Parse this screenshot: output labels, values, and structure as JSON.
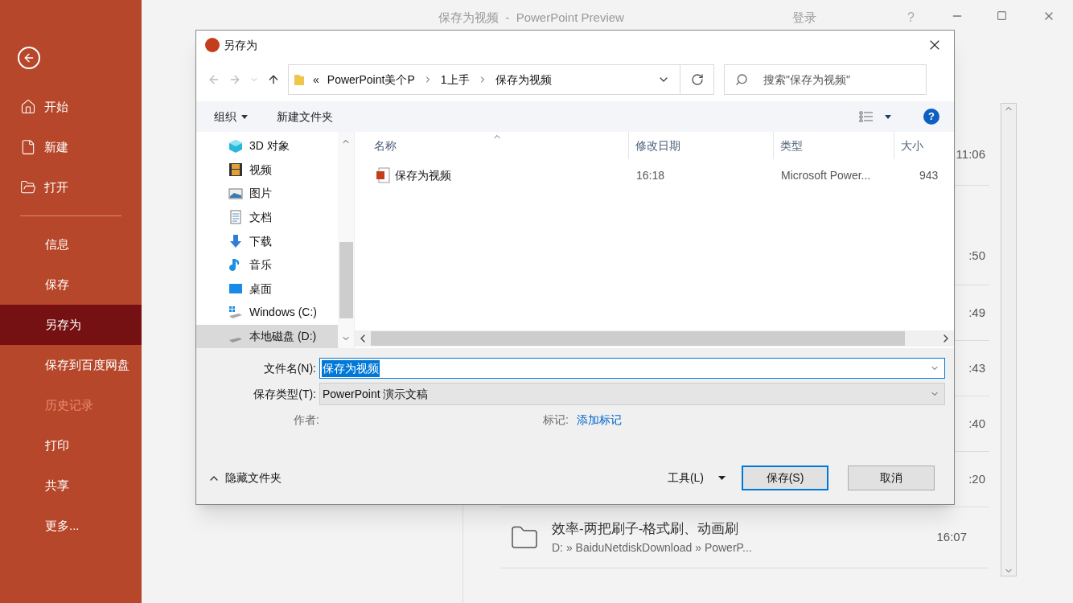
{
  "app": {
    "title": "保存为视频  -  PowerPoint Preview",
    "sign_in": "登录",
    "help": "?"
  },
  "sidebar": {
    "top_items": [
      {
        "label": "开始"
      },
      {
        "label": "新建"
      },
      {
        "label": "打开"
      }
    ],
    "items": [
      {
        "label": "信息",
        "selected": false,
        "disabled": false
      },
      {
        "label": "保存",
        "selected": false,
        "disabled": false
      },
      {
        "label": "另存为",
        "selected": true,
        "disabled": false
      },
      {
        "label": "保存到百度网盘",
        "selected": false,
        "disabled": false
      },
      {
        "label": "历史记录",
        "selected": false,
        "disabled": true
      },
      {
        "label": "打印",
        "selected": false,
        "disabled": false
      },
      {
        "label": "共享",
        "selected": false,
        "disabled": false
      },
      {
        "label": "更多...",
        "selected": false,
        "disabled": false
      }
    ]
  },
  "backstage": {
    "recent_times": [
      "11:06",
      ":50",
      ":49",
      ":43",
      ":40",
      ":20"
    ],
    "folder": {
      "name": "效率-两把刷子-格式刷、动画刷",
      "path": "D: » BaiduNetdiskDownload » PowerP...",
      "time": "16:07"
    }
  },
  "dialog": {
    "title": "另存为",
    "breadcrumb": {
      "overflow": "«",
      "parts": [
        "PowerPoint美个P",
        "1上手",
        "保存为视频"
      ]
    },
    "search": {
      "placeholder": "搜索\"保存为视频\""
    },
    "toolbar": {
      "organize": "组织",
      "new_folder": "新建文件夹"
    },
    "nav": [
      {
        "label": "3D 对象",
        "selected": false
      },
      {
        "label": "视频",
        "selected": false
      },
      {
        "label": "图片",
        "selected": false
      },
      {
        "label": "文档",
        "selected": false
      },
      {
        "label": "下载",
        "selected": false
      },
      {
        "label": "音乐",
        "selected": false
      },
      {
        "label": "桌面",
        "selected": false
      },
      {
        "label": "Windows (C:)",
        "selected": false
      },
      {
        "label": "本地磁盘 (D:)",
        "selected": true
      }
    ],
    "columns": [
      "名称",
      "修改日期",
      "类型",
      "大小"
    ],
    "rows": [
      {
        "name": "保存为视频",
        "date": "16:18",
        "type": "Microsoft Power...",
        "size": "943"
      }
    ],
    "file_name": {
      "label": "文件名(N):",
      "value": "保存为视频"
    },
    "file_type": {
      "label": "保存类型(T):",
      "value": "PowerPoint 演示文稿"
    },
    "author_label": "作者:",
    "tags_label": "标记:",
    "tags_link": "添加标记",
    "hide_folders": "隐藏文件夹",
    "tools": "工具(L)",
    "save": "保存(S)",
    "cancel": "取消"
  }
}
